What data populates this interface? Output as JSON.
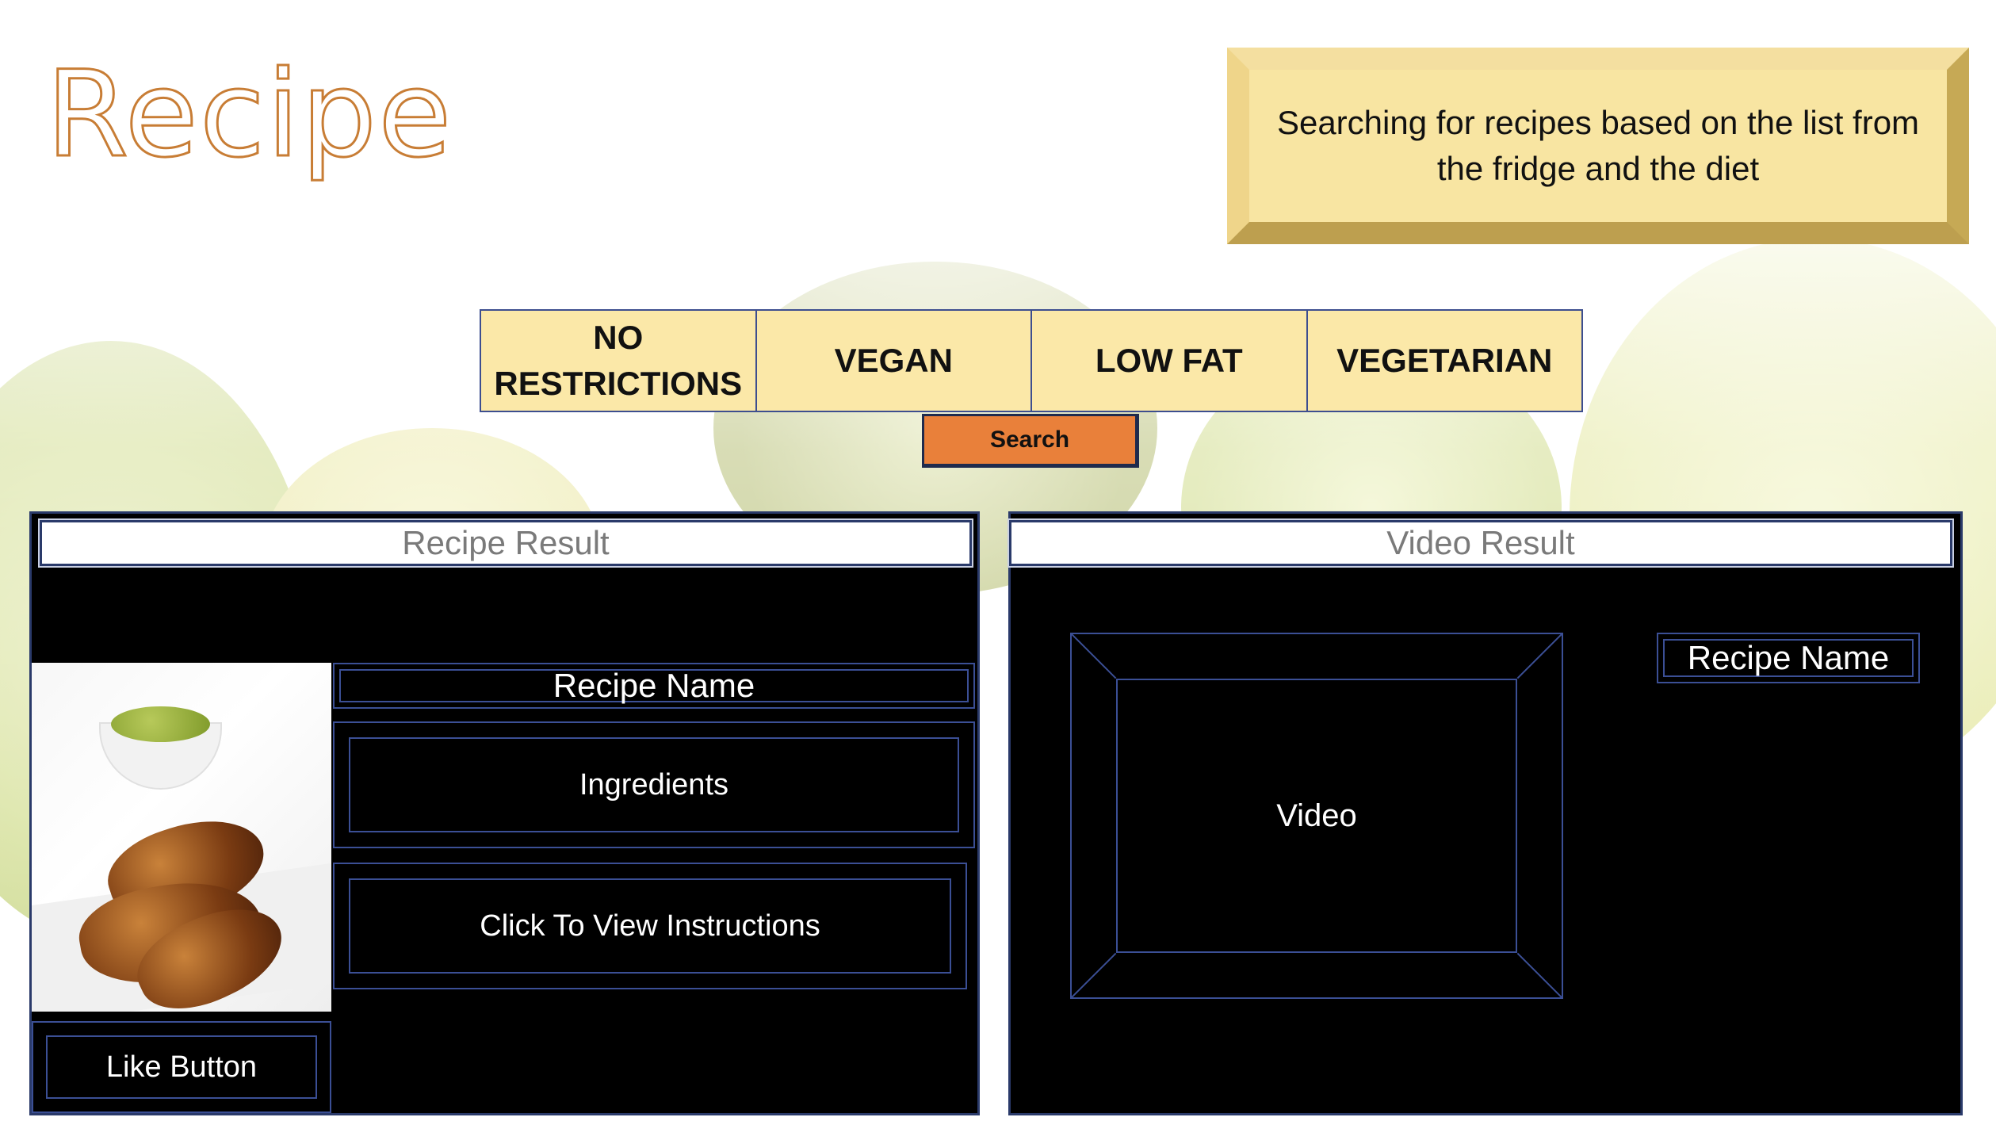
{
  "title": "Recipe",
  "note": "Searching for recipes based on the list from the fridge and the diet",
  "filters": [
    {
      "label": "NO\nRESTRICTIONS"
    },
    {
      "label": "VEGAN"
    },
    {
      "label": "LOW FAT"
    },
    {
      "label": "VEGETARIAN"
    }
  ],
  "search_label": "Search",
  "recipe_panel": {
    "header": "Recipe Result",
    "recipe_name": "Recipe Name",
    "ingredients": "Ingredients",
    "instructions": "Click To View Instructions",
    "like": "Like Button"
  },
  "video_panel": {
    "header": "Video Result",
    "video": "Video",
    "recipe_name": "Recipe Name"
  },
  "colors": {
    "title_outline": "#c87d35",
    "note_bg": "#f8e5a2",
    "filter_bg": "#fbe8a8",
    "search_bg": "#e9803a",
    "panel_bg": "#000000",
    "frame_border": "#3b4f95"
  }
}
